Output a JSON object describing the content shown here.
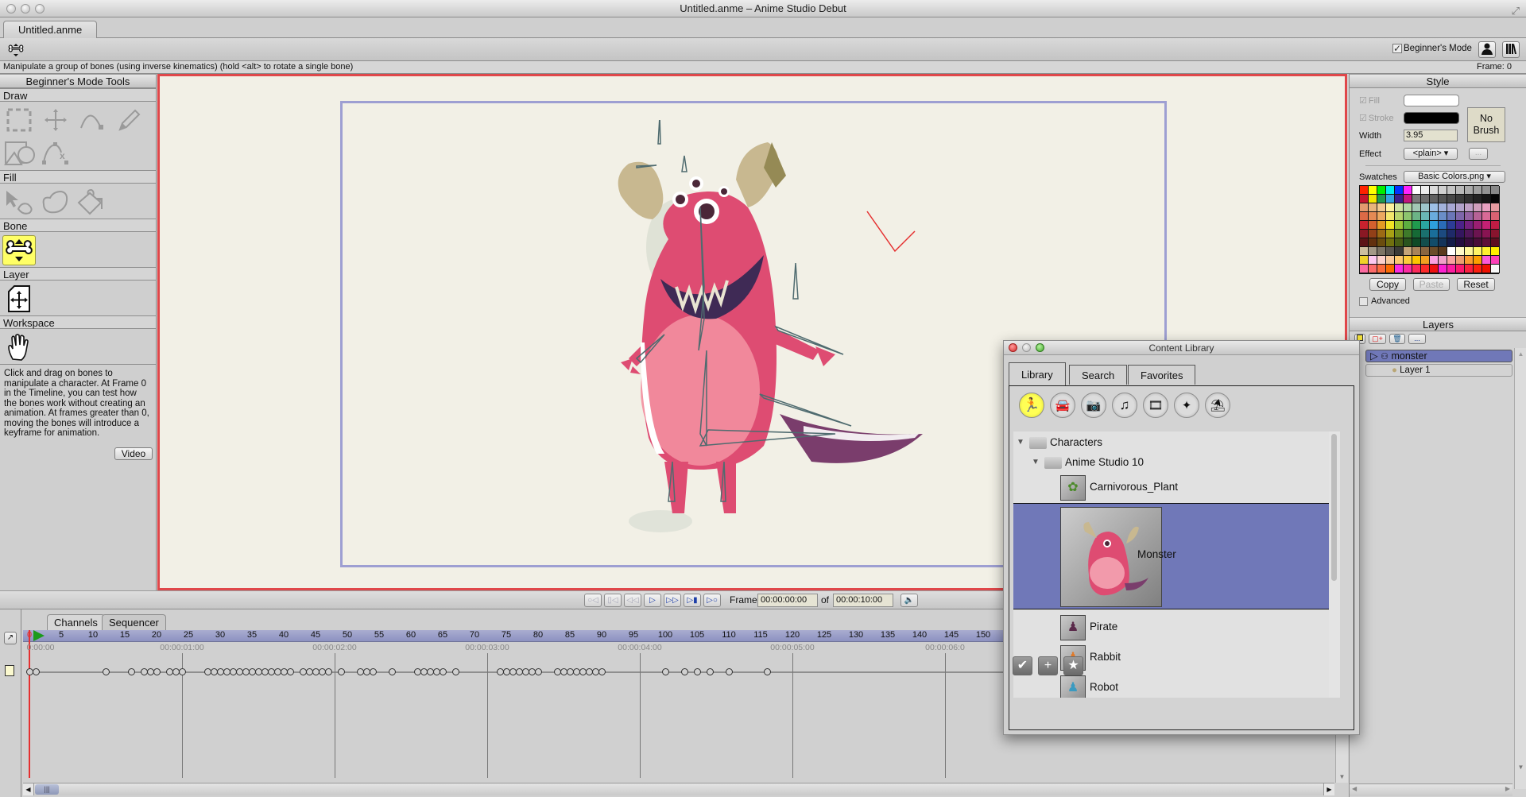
{
  "window": {
    "title": "Untitled.anme – Anime Studio Debut",
    "document_tab": "Untitled.anme"
  },
  "toolbar": {
    "current_tool_icon": "bone-manipulate-icon",
    "beginners_mode_label": "Beginner's Mode",
    "beginners_mode_checked": true,
    "character_wizard_icon": "person-icon",
    "library_icon": "library-books-icon"
  },
  "status": {
    "message": "Manipulate a group of bones (using inverse kinematics) (hold <alt> to rotate a single bone)",
    "frame_readout": "Frame: 0"
  },
  "tools_panel": {
    "header": "Beginner's Mode Tools",
    "sections": [
      {
        "label": "Draw",
        "tools": [
          "select-points-icon",
          "transform-points-icon",
          "add-point-icon",
          "freehand-icon",
          "draw-shape-icon",
          "delete-edge-icon"
        ]
      },
      {
        "label": "Fill",
        "tools": [
          "select-shape-icon",
          "create-shape-icon",
          "paint-bucket-icon"
        ]
      },
      {
        "label": "Bone",
        "tools": [
          "manipulate-bones-icon"
        ],
        "selected": "manipulate-bones-icon"
      },
      {
        "label": "Layer",
        "tools": [
          "transform-layer-icon"
        ]
      },
      {
        "label": "Workspace",
        "tools": [
          "hand-pan-icon"
        ]
      }
    ],
    "help_text": "Click and drag on bones to manipulate a character. At Frame 0 in the Timeline, you can test how the bones work without creating an animation. At frames greater than 0, moving the bones will introduce a keyframe for animation.",
    "video_button": "Video"
  },
  "canvas": {
    "background": "#f2f0e6",
    "active_border_color": "#e0474a",
    "frame_guide_color": "#9e9fd2",
    "content": "Monster character with bones"
  },
  "playback": {
    "buttons": [
      "rewind",
      "step-back",
      "play-back",
      "play",
      "step-forward",
      "fast-forward",
      "end"
    ],
    "frame_label": "Frame",
    "current_time": "00:00:00:00",
    "of_label": "of",
    "total_time": "00:00:10:00",
    "audio_icon": "speaker-icon"
  },
  "timeline": {
    "tabs": [
      "Channels",
      "Sequencer"
    ],
    "active_tab": "Channels",
    "current_frame": 0,
    "ruler_numbers": [
      "0",
      "5",
      "10",
      "15",
      "20",
      "25",
      "30",
      "35",
      "40",
      "45",
      "50",
      "55",
      "60",
      "65",
      "70",
      "75",
      "80",
      "85",
      "90",
      "95",
      "100",
      "105",
      "110",
      "115",
      "120",
      "125",
      "130",
      "135",
      "140",
      "145",
      "150"
    ],
    "timecodes": [
      "0:00:00",
      "00:00:01:00",
      "00:00:02:00",
      "00:00:03:00",
      "00:00:04:00",
      "00:00:05:00",
      "00:00:06:0"
    ],
    "keyframes": [
      0,
      1,
      12,
      16,
      18,
      19,
      20,
      22,
      23,
      24,
      28,
      29,
      30,
      31,
      32,
      33,
      34,
      35,
      36,
      37,
      38,
      39,
      40,
      41,
      43,
      44,
      45,
      46,
      47,
      49,
      52,
      53,
      54,
      57,
      61,
      62,
      63,
      64,
      65,
      67,
      74,
      75,
      76,
      77,
      78,
      79,
      80,
      83,
      84,
      85,
      86,
      87,
      88,
      89,
      90,
      100,
      103,
      105,
      107,
      110,
      116
    ]
  },
  "style_panel": {
    "header": "Style",
    "fill_label": "Fill",
    "fill_color": "#ffffff",
    "stroke_label": "Stroke",
    "stroke_color": "#000000",
    "width_label": "Width",
    "width_value": "3.95",
    "effect_label": "Effect",
    "effect_value": "<plain>",
    "effect_more": "...",
    "brush_label": "No Brush",
    "swatches_label": "Swatches",
    "swatches_value": "Basic Colors.png",
    "swatch_colors": [
      [
        "#ff2200",
        "#ffff00",
        "#00ee00",
        "#00eeee",
        "#0033ff",
        "#ff22ff",
        "#ffffff",
        "#eeeeee",
        "#dddddd",
        "#d0d0d0",
        "#c4c4c4",
        "#b8b8b8",
        "#ababab",
        "#9f9f9f",
        "#939393",
        "#888888"
      ],
      [
        "#c4142f",
        "#f2e600",
        "#1f9a4f",
        "#35a2e2",
        "#3b1d8c",
        "#c2157e",
        "#7a7a7a",
        "#6d6d6d",
        "#606060",
        "#535353",
        "#474747",
        "#3b3b3b",
        "#2f2f2f",
        "#232323",
        "#161616",
        "#050505"
      ],
      [
        "#e49a6e",
        "#e8b47c",
        "#f0c890",
        "#fdf29e",
        "#cde2a2",
        "#b1d6a4",
        "#a2c8b4",
        "#9ec6cc",
        "#9ec0e6",
        "#a2b2dc",
        "#a8a8d4",
        "#b2a2ca",
        "#c0a0c6",
        "#d09ebc",
        "#e8a0c0",
        "#e69aa0"
      ],
      [
        "#dc6a46",
        "#e48a54",
        "#eca860",
        "#f4e66c",
        "#b8d46c",
        "#8cc46e",
        "#6cb486",
        "#6ab6b6",
        "#6aacde",
        "#6a8ec8",
        "#6a76b8",
        "#7e66aa",
        "#9462a2",
        "#b66296",
        "#d86a96",
        "#da6272"
      ],
      [
        "#c8222e",
        "#d4602e",
        "#e49a24",
        "#f2e224",
        "#9cc434",
        "#5cae40",
        "#209a4e",
        "#2aa4a0",
        "#2ea0dc",
        "#2a6cb8",
        "#2c3c96",
        "#4c2288",
        "#74207e",
        "#9a1e72",
        "#c42074",
        "#c01c44"
      ],
      [
        "#8a1824",
        "#924018",
        "#9c6a14",
        "#a8a014",
        "#6e8a1e",
        "#3e7a2a",
        "#166a36",
        "#1a706e",
        "#1a6e9a",
        "#1c4a80",
        "#1e2a68",
        "#34165e",
        "#501658",
        "#6c1450",
        "#881452",
        "#88142e"
      ],
      [
        "#5c1416",
        "#62300e",
        "#6a4c0e",
        "#70700e",
        "#4a5e14",
        "#2a541e",
        "#0e4a26",
        "#124e4c",
        "#124c6a",
        "#14345a",
        "#141c48",
        "#240e40",
        "#380e3c",
        "#4a0e38",
        "#5e0e38",
        "#5e0e20"
      ],
      [
        "#cdbf9f",
        "#a39987",
        "#7c7466",
        "#5a5650",
        "#3a3a38",
        "#c4a478",
        "#a8845a",
        "#8a6640",
        "#6c4c2a",
        "#5a3a1c",
        "#ffffff",
        "#fffac8",
        "#fff89a",
        "#fff466",
        "#fff030",
        "#ffee00"
      ],
      [
        "#f0d22a",
        "#fcc8f0",
        "#fcd0cc",
        "#f8c89c",
        "#fcc870",
        "#fcca3c",
        "#fcc400",
        "#f2a020",
        "#fca0e0",
        "#f0a0c8",
        "#f8a0a0",
        "#ec9c72",
        "#fc9c30",
        "#fca000",
        "#fc5ad8",
        "#fc40b8"
      ],
      [
        "#fc6aa0",
        "#fc6a6a",
        "#fc6a3c",
        "#fc6a00",
        "#fc2ae0",
        "#fc2aa0",
        "#fc2a5a",
        "#fc2a2a",
        "#ee1010",
        "#fc20d0",
        "#fc1ca0",
        "#fc1870",
        "#fc2040",
        "#fc2010",
        "#ee1000",
        "#f8f8f8"
      ]
    ],
    "copy_button": "Copy",
    "paste_button": "Paste",
    "reset_button": "Reset",
    "advanced_label": "Advanced",
    "advanced_checked": false
  },
  "layers_panel": {
    "header": "Layers",
    "toolbar": [
      "new-layer-icon",
      "new-layer-add-icon",
      "delete-layer-icon",
      "more-icon"
    ],
    "more_label": "...",
    "layers": [
      {
        "name": "monster",
        "type": "bone",
        "selected": true,
        "expanded": false
      },
      {
        "name": "Layer 1",
        "type": "vector",
        "selected": false
      }
    ]
  },
  "content_library": {
    "title": "Content Library",
    "tabs": [
      "Library",
      "Search",
      "Favorites"
    ],
    "active_tab": "Library",
    "categories": [
      "characters-icon",
      "car-icon",
      "camera-icon",
      "music-note-icon",
      "film-icon",
      "particles-icon",
      "beach-umbrella-icon"
    ],
    "active_category": "characters-icon",
    "tree": {
      "root": "Characters",
      "folder": "Anime Studio 10",
      "items": [
        {
          "name": "Carnivorous_Plant",
          "selected": false
        },
        {
          "name": "Monster",
          "selected": true
        },
        {
          "name": "Pirate",
          "selected": false
        },
        {
          "name": "Rabbit",
          "selected": false
        },
        {
          "name": "Robot",
          "selected": false
        }
      ]
    },
    "footer_buttons": [
      "checkmark-icon",
      "plus-icon",
      "star-icon"
    ],
    "selection_color": "#7078b8"
  }
}
